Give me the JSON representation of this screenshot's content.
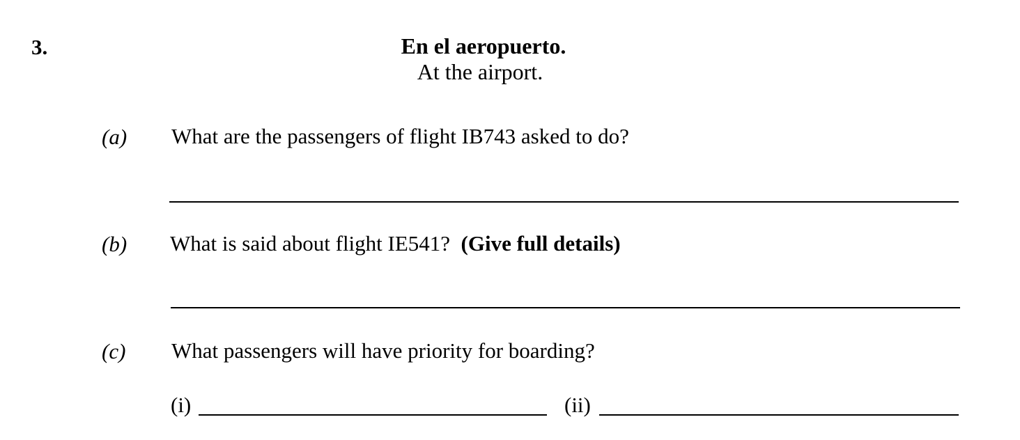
{
  "question": {
    "number": "3.",
    "title": "En el aeropuerto.",
    "subtitle": "At the airport."
  },
  "parts": {
    "a": {
      "label": "(a)",
      "text": "What are the passengers of flight IB743 asked to do?"
    },
    "b": {
      "label": "(b)",
      "text": "What is said about flight IE541?",
      "emphasis": "(Give full details)"
    },
    "c": {
      "label": "(c)",
      "text": "What passengers will have priority for boarding?",
      "sub_i": "(i)",
      "sub_ii": "(ii)"
    }
  }
}
